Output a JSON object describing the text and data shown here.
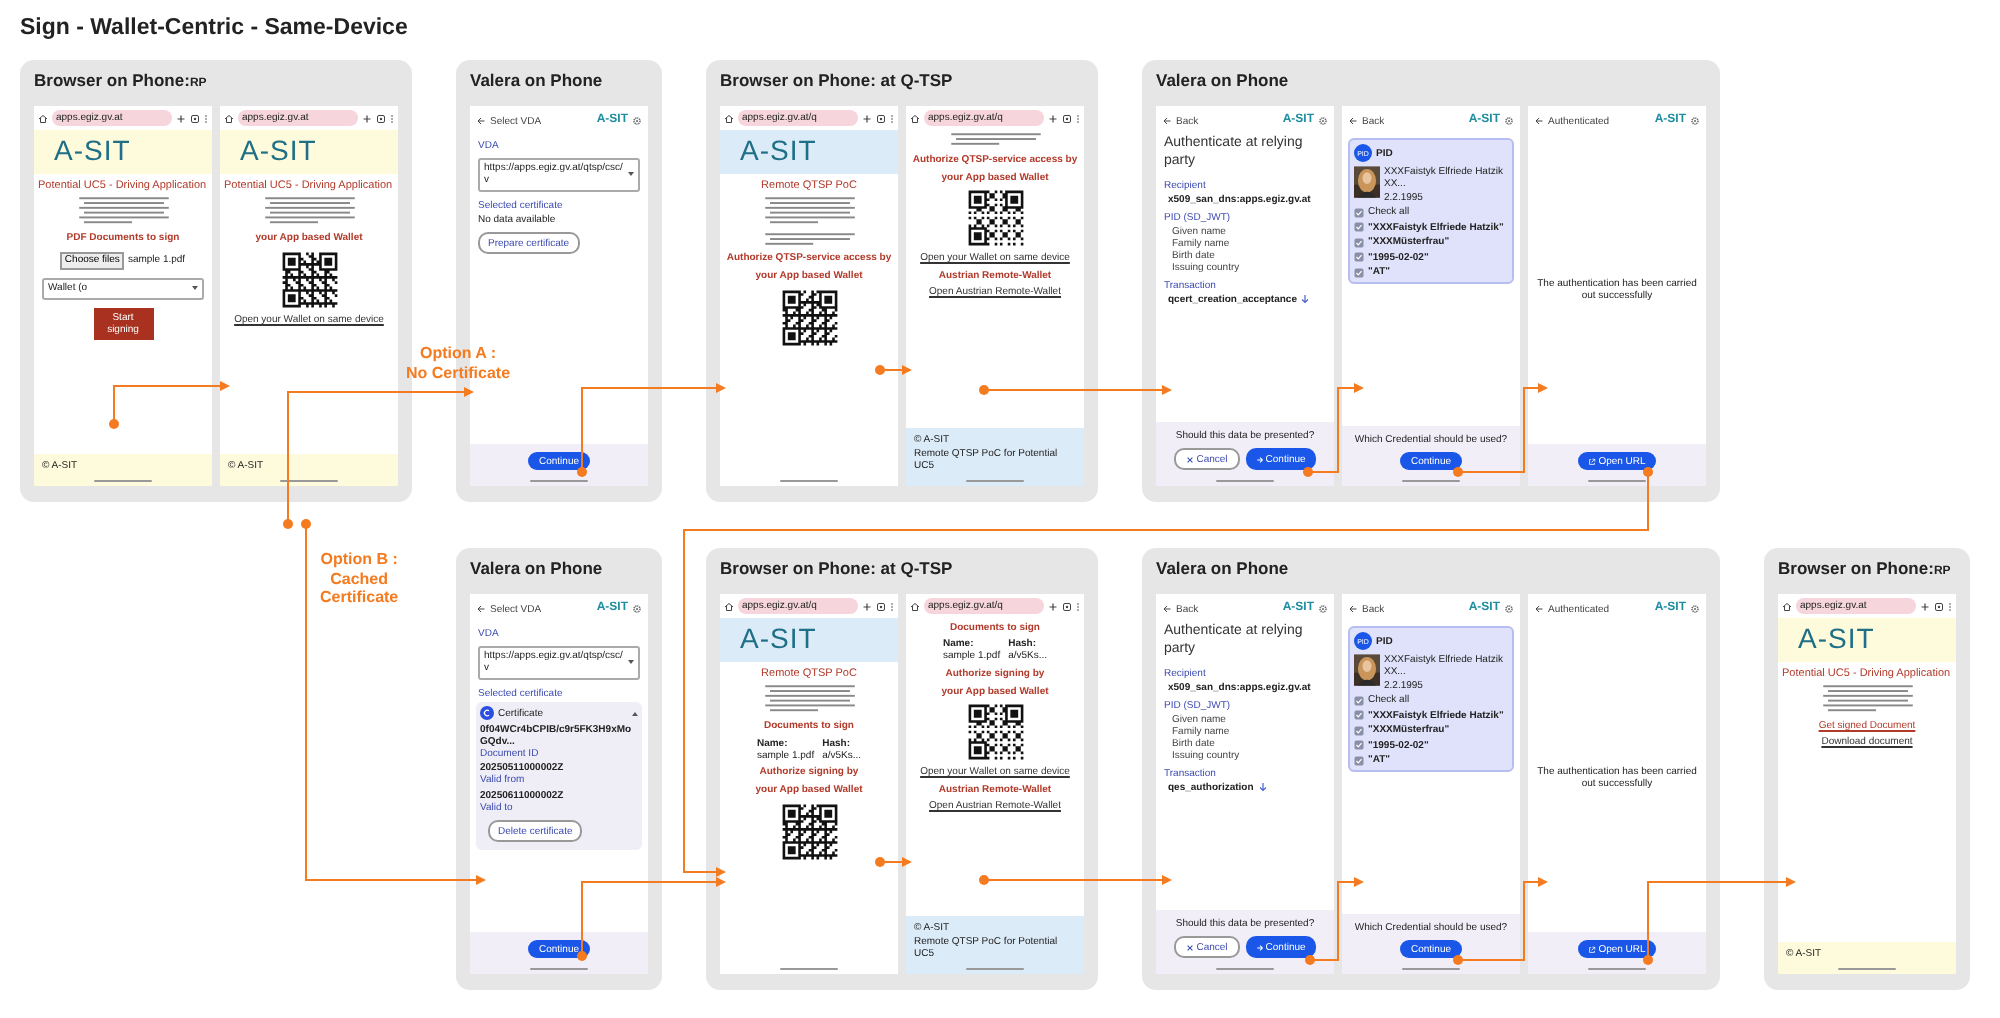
{
  "title": "Sign - Wallet-Centric - Same-Device",
  "annotations": [
    {
      "lines": [
        "Option A :",
        "No Certificate"
      ]
    },
    {
      "lines": [
        "Option B :",
        "Cached",
        "Certificate"
      ]
    }
  ],
  "rows": [
    {
      "panels": [
        {
          "title": "Browser on Phone:",
          "suffix": "RP",
          "screens": [
            {
              "elements": [
                {
                  "kind": "browser_bar",
                  "url": "apps.egiz.gv.at"
                },
                {
                  "kind": "rp_banner",
                  "logo": "A-SIT"
                },
                {
                  "kind": "heading",
                  "text": "Potential UC5 - Driving Application"
                },
                {
                  "kind": "paragraph"
                },
                {
                  "kind": "red_label",
                  "text": "PDF Documents to sign"
                },
                {
                  "kind": "file_row",
                  "button": "Choose files",
                  "file": "sample 1.pdf"
                },
                {
                  "kind": "select",
                  "value": "Wallet (o"
                },
                {
                  "kind": "red_button",
                  "text": "Start signing"
                },
                {
                  "kind": "spacer"
                },
                {
                  "kind": "rp_footer",
                  "lines": [
                    "© A-SIT"
                  ]
                }
              ]
            },
            {
              "elements": [
                {
                  "kind": "browser_bar",
                  "url": "apps.egiz.gv.at"
                },
                {
                  "kind": "rp_banner",
                  "logo": "A-SIT"
                },
                {
                  "kind": "heading",
                  "text": "Potential UC5 - Driving Application"
                },
                {
                  "kind": "paragraph"
                },
                {
                  "kind": "red_label",
                  "text": "your App based Wallet"
                },
                {
                  "kind": "qr"
                },
                {
                  "kind": "link",
                  "text": "Open your Wallet on same device"
                },
                {
                  "kind": "spacer"
                },
                {
                  "kind": "rp_footer",
                  "lines": [
                    "© A-SIT"
                  ]
                }
              ]
            }
          ]
        },
        {
          "title": "Valera on Phone",
          "screens": [
            {
              "elements": [
                {
                  "kind": "app_bar",
                  "title": "Select VDA",
                  "brand": "A-SIT"
                },
                {
                  "kind": "label",
                  "text": "VDA"
                },
                {
                  "kind": "select",
                  "value": "https://apps.egiz.gv.at/qtsp/csc/v"
                },
                {
                  "kind": "label",
                  "text": "Selected certificate"
                },
                {
                  "kind": "text",
                  "text": "No data available"
                },
                {
                  "kind": "outline_button",
                  "text": "Prepare certificate"
                },
                {
                  "kind": "spacer"
                },
                {
                  "kind": "bottom_bar",
                  "buttons": [
                    {
                      "kind": "continue",
                      "text": "Continue"
                    }
                  ]
                }
              ]
            }
          ]
        },
        {
          "title": "Browser on Phone: at Q-TSP",
          "screens": [
            {
              "elements": [
                {
                  "kind": "browser_bar",
                  "url": "apps.egiz.gv.at/q"
                },
                {
                  "kind": "qtsp_banner",
                  "logo": "A-SIT"
                },
                {
                  "kind": "centered_heading",
                  "text": "Remote QTSP PoC"
                },
                {
                  "kind": "paragraph"
                },
                {
                  "kind": "short_paragraph"
                },
                {
                  "kind": "red_label",
                  "text": "Authorize QTSP-service access by"
                },
                {
                  "kind": "red_label",
                  "text": "your App based Wallet"
                },
                {
                  "kind": "qr"
                }
              ]
            },
            {
              "elements": [
                {
                  "kind": "browser_bar",
                  "url": "apps.egiz.gv.at/q"
                },
                {
                  "kind": "short_paragraph"
                },
                {
                  "kind": "red_label",
                  "text": "Authorize QTSP-service access by"
                },
                {
                  "kind": "red_label",
                  "text": "your App based Wallet"
                },
                {
                  "kind": "qr"
                },
                {
                  "kind": "link",
                  "text": "Open your Wallet on same device"
                },
                {
                  "kind": "red_label",
                  "text": "Austrian Remote-Wallet"
                },
                {
                  "kind": "link",
                  "text": "Open Austrian Remote-Wallet"
                },
                {
                  "kind": "spacer"
                },
                {
                  "kind": "qtsp_footer",
                  "lines": [
                    "© A-SIT",
                    "Remote QTSP PoC for Potential UC5"
                  ]
                }
              ]
            }
          ]
        },
        {
          "title": "Valera on Phone",
          "screens": [
            {
              "elements": [
                {
                  "kind": "app_bar",
                  "title": "Back",
                  "brand": "A-SIT"
                },
                {
                  "kind": "big_title",
                  "text": "Authenticate at relying party"
                },
                {
                  "kind": "label",
                  "text": "Recipient"
                },
                {
                  "kind": "value",
                  "text": "x509_san_dns:apps.egiz.gv.at"
                },
                {
                  "kind": "label",
                  "text": "PID (SD_JWT)"
                },
                {
                  "kind": "list",
                  "items": [
                    "Given name",
                    "Family name",
                    "Birth date",
                    "Issuing country"
                  ]
                },
                {
                  "kind": "label",
                  "text": "Transaction"
                },
                {
                  "kind": "value",
                  "text": "qcert_creation_acceptance",
                  "icon": true
                },
                {
                  "kind": "spacer"
                },
                {
                  "kind": "bottom_bar",
                  "prompt": "Should this data be presented?",
                  "buttons": [
                    {
                      "kind": "cancel",
                      "text": "Cancel"
                    },
                    {
                      "kind": "confirm",
                      "text": "Continue"
                    }
                  ]
                }
              ]
            },
            {
              "elements": [
                {
                  "kind": "app_bar",
                  "title": "Back",
                  "brand": "A-SIT"
                },
                {
                  "kind": "pid_card",
                  "badge": "PID",
                  "title": "PID",
                  "name": "XXXFaistyk Elfriede Hatzik XX...",
                  "date": "2.2.1995",
                  "checks": [
                    {
                      "text": "Check all",
                      "checked": true
                    },
                    {
                      "text": "\"XXXFaistyk Elfriede Hatzik\"",
                      "checked": true
                    },
                    {
                      "text": "\"XXXMüsterfrau\"",
                      "checked": true
                    },
                    {
                      "text": "\"1995-02-02\"",
                      "checked": true
                    },
                    {
                      "text": "\"AT\"",
                      "checked": true
                    }
                  ]
                },
                {
                  "kind": "spacer"
                },
                {
                  "kind": "bottom_bar",
                  "prompt": "Which Credential should be used?",
                  "buttons": [
                    {
                      "kind": "continue",
                      "text": "Continue"
                    }
                  ]
                }
              ]
            },
            {
              "elements": [
                {
                  "kind": "app_bar",
                  "title": "Authenticated",
                  "brand": "A-SIT"
                },
                {
                  "kind": "spacer"
                },
                {
                  "kind": "center_text",
                  "text": "The authentication has been carried out successfully"
                },
                {
                  "kind": "spacer"
                },
                {
                  "kind": "bottom_bar",
                  "buttons": [
                    {
                      "kind": "open",
                      "text": "Open URL"
                    }
                  ]
                }
              ]
            }
          ]
        }
      ]
    },
    {
      "panels": [
        {
          "title": "Valera on Phone",
          "screens": [
            {
              "elements": [
                {
                  "kind": "app_bar",
                  "title": "Select VDA",
                  "brand": "A-SIT"
                },
                {
                  "kind": "label",
                  "text": "VDA"
                },
                {
                  "kind": "select",
                  "value": "https://apps.egiz.gv.at/qtsp/csc/v"
                },
                {
                  "kind": "label",
                  "text": "Selected certificate"
                },
                {
                  "kind": "cert_card",
                  "title": "Certificate",
                  "rows": [
                    {
                      "value": "0f04WCr4bCPIB/c9r5FK3H9xMoGQdv...",
                      "caption": "Document ID"
                    },
                    {
                      "value": "20250511000002Z",
                      "caption": "Valid from"
                    },
                    {
                      "value": "20250611000002Z",
                      "caption": "Valid to"
                    }
                  ],
                  "button": "Delete certificate"
                },
                {
                  "kind": "spacer"
                },
                {
                  "kind": "bottom_bar",
                  "buttons": [
                    {
                      "kind": "continue",
                      "text": "Continue"
                    }
                  ]
                }
              ]
            }
          ]
        },
        {
          "title": "Browser on Phone: at Q-TSP",
          "screens": [
            {
              "elements": [
                {
                  "kind": "browser_bar",
                  "url": "apps.egiz.gv.at/q"
                },
                {
                  "kind": "qtsp_banner",
                  "logo": "A-SIT"
                },
                {
                  "kind": "centered_heading",
                  "text": "Remote QTSP PoC"
                },
                {
                  "kind": "paragraph"
                },
                {
                  "kind": "red_label",
                  "text": "Documents to sign"
                },
                {
                  "kind": "doc_table",
                  "items": [
                    {
                      "label": "Name:",
                      "value": "sample 1.pdf"
                    },
                    {
                      "label": "Hash:",
                      "value": "a/v5Ks..."
                    }
                  ]
                },
                {
                  "kind": "red_label",
                  "text": "Authorize signing by"
                },
                {
                  "kind": "red_label",
                  "text": "your App based Wallet"
                },
                {
                  "kind": "qr"
                }
              ]
            },
            {
              "elements": [
                {
                  "kind": "browser_bar",
                  "url": "apps.egiz.gv.at/q"
                },
                {
                  "kind": "red_label",
                  "text": "Documents to sign"
                },
                {
                  "kind": "doc_table",
                  "items": [
                    {
                      "label": "Name:",
                      "value": "sample 1.pdf"
                    },
                    {
                      "label": "Hash:",
                      "value": "a/v5Ks..."
                    }
                  ]
                },
                {
                  "kind": "red_label",
                  "text": "Authorize signing by"
                },
                {
                  "kind": "red_label",
                  "text": "your App based Wallet"
                },
                {
                  "kind": "qr"
                },
                {
                  "kind": "link",
                  "text": "Open your Wallet on same device"
                },
                {
                  "kind": "red_label",
                  "text": "Austrian Remote-Wallet"
                },
                {
                  "kind": "link",
                  "text": "Open Austrian Remote-Wallet"
                },
                {
                  "kind": "spacer"
                },
                {
                  "kind": "qtsp_footer",
                  "lines": [
                    "© A-SIT",
                    "Remote QTSP PoC for Potential UC5"
                  ]
                }
              ]
            }
          ]
        },
        {
          "title": "Valera on Phone",
          "screens": [
            {
              "elements": [
                {
                  "kind": "app_bar",
                  "title": "Back",
                  "brand": "A-SIT"
                },
                {
                  "kind": "big_title",
                  "text": "Authenticate at relying party"
                },
                {
                  "kind": "label",
                  "text": "Recipient"
                },
                {
                  "kind": "value",
                  "text": "x509_san_dns:apps.egiz.gv.at"
                },
                {
                  "kind": "label",
                  "text": "PID (SD_JWT)"
                },
                {
                  "kind": "list",
                  "items": [
                    "Given name",
                    "Family name",
                    "Birth date",
                    "Issuing country"
                  ]
                },
                {
                  "kind": "label",
                  "text": "Transaction"
                },
                {
                  "kind": "value",
                  "text": "qes_authorization",
                  "icon": true
                },
                {
                  "kind": "spacer"
                },
                {
                  "kind": "bottom_bar",
                  "prompt": "Should this data be presented?",
                  "buttons": [
                    {
                      "kind": "cancel",
                      "text": "Cancel"
                    },
                    {
                      "kind": "confirm",
                      "text": "Continue"
                    }
                  ]
                }
              ]
            },
            {
              "elements": [
                {
                  "kind": "app_bar",
                  "title": "Back",
                  "brand": "A-SIT"
                },
                {
                  "kind": "pid_card",
                  "badge": "PID",
                  "title": "PID",
                  "name": "XXXFaistyk Elfriede Hatzik XX...",
                  "date": "2.2.1995",
                  "checks": [
                    {
                      "text": "Check all",
                      "checked": true
                    },
                    {
                      "text": "\"XXXFaistyk Elfriede Hatzik\"",
                      "checked": true
                    },
                    {
                      "text": "\"XXXMüsterfrau\"",
                      "checked": true
                    },
                    {
                      "text": "\"1995-02-02\"",
                      "checked": true
                    },
                    {
                      "text": "\"AT\"",
                      "checked": true
                    }
                  ]
                },
                {
                  "kind": "spacer"
                },
                {
                  "kind": "bottom_bar",
                  "prompt": "Which Credential should be used?",
                  "buttons": [
                    {
                      "kind": "continue",
                      "text": "Continue"
                    }
                  ]
                }
              ]
            },
            {
              "elements": [
                {
                  "kind": "app_bar",
                  "title": "Authenticated",
                  "brand": "A-SIT"
                },
                {
                  "kind": "spacer"
                },
                {
                  "kind": "center_text",
                  "text": "The authentication has been carried out successfully"
                },
                {
                  "kind": "spacer"
                },
                {
                  "kind": "bottom_bar",
                  "buttons": [
                    {
                      "kind": "open",
                      "text": "Open URL"
                    }
                  ]
                }
              ]
            }
          ]
        },
        {
          "title": "Browser on Phone:",
          "suffix": "RP",
          "screens": [
            {
              "elements": [
                {
                  "kind": "browser_bar",
                  "url": "apps.egiz.gv.at"
                },
                {
                  "kind": "rp_banner",
                  "logo": "A-SIT"
                },
                {
                  "kind": "heading",
                  "text": "Potential UC5 - Driving Application"
                },
                {
                  "kind": "paragraph"
                },
                {
                  "kind": "red_link",
                  "text": "Get signed Document"
                },
                {
                  "kind": "link",
                  "text": "Download document"
                },
                {
                  "kind": "spacer"
                },
                {
                  "kind": "rp_footer",
                  "lines": [
                    "© A-SIT"
                  ]
                }
              ]
            }
          ]
        }
      ]
    }
  ]
}
